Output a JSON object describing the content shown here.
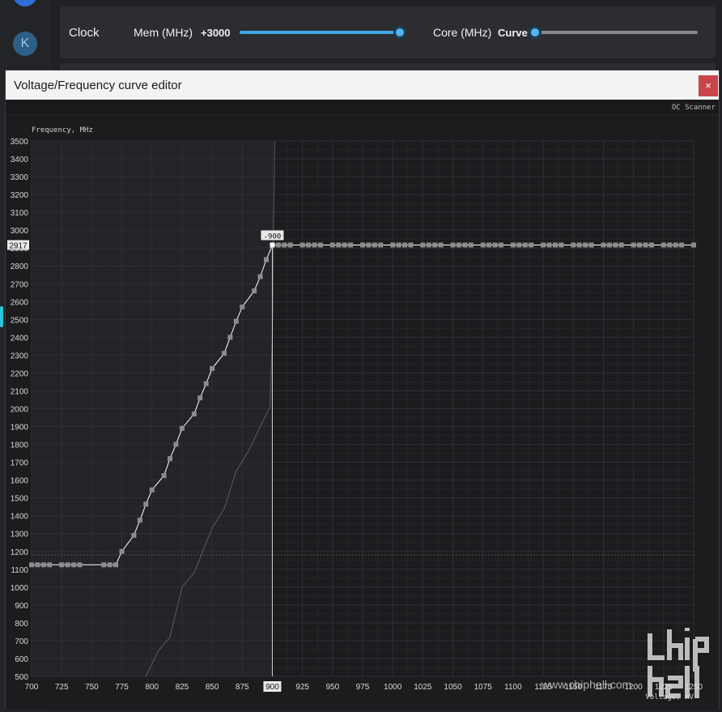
{
  "sidebar": {
    "avatar_letter": "K"
  },
  "clock_panel": {
    "label": "Clock",
    "mem_label": "Mem (MHz)",
    "mem_value": "+3000",
    "mem_slider_fraction": 1.0,
    "core_label": "Core (MHz)",
    "core_value": "Curve",
    "core_slider_fraction": 0.0
  },
  "editor": {
    "title": "Voltage/Frequency curve editor",
    "close_glyph": "×",
    "oc_scanner_label": "OC Scanner",
    "watermark_url": "www.chiphell.com"
  },
  "colors": {
    "accent": "#3fa7e8",
    "close": "#c8454a",
    "curve": "#ffffff",
    "point": "#8c8c8c",
    "selected_label_bg": "#e8e8e8"
  },
  "chart_data": {
    "type": "line",
    "ylabel": "Frequency, MHz",
    "xlabel": "Voltage, mV",
    "xlim": [
      700,
      1250
    ],
    "ylim": [
      500,
      3500
    ],
    "x_ticks": [
      700,
      725,
      750,
      775,
      800,
      825,
      850,
      875,
      900,
      925,
      950,
      975,
      1000,
      1025,
      1050,
      1075,
      1100,
      1125,
      1150,
      1175,
      1200,
      1225,
      1250
    ],
    "y_ticks": [
      500,
      600,
      700,
      800,
      900,
      1000,
      1100,
      1200,
      1300,
      1400,
      1500,
      1600,
      1700,
      1800,
      1900,
      2000,
      2100,
      2200,
      2300,
      2400,
      2500,
      2600,
      2700,
      2800,
      2900,
      3000,
      3100,
      3200,
      3300,
      3400,
      3500
    ],
    "selected_point": {
      "voltage": 900,
      "frequency": 2917,
      "voltage_label": "900",
      "frequency_label": "2917",
      "marker_label": "-900"
    },
    "locked_line_frequency": 1180,
    "series": [
      {
        "points": [
          [
            700,
            1125
          ],
          [
            705,
            1125
          ],
          [
            710,
            1125
          ],
          [
            715,
            1125
          ],
          [
            725,
            1125
          ],
          [
            730,
            1125
          ],
          [
            735,
            1125
          ],
          [
            740,
            1125
          ],
          [
            760,
            1125
          ],
          [
            765,
            1125
          ],
          [
            770,
            1125
          ],
          [
            775,
            1200
          ],
          [
            785,
            1290
          ],
          [
            790,
            1375
          ],
          [
            795,
            1465
          ],
          [
            800,
            1545
          ],
          [
            810,
            1625
          ],
          [
            815,
            1720
          ],
          [
            820,
            1800
          ],
          [
            825,
            1890
          ],
          [
            835,
            1970
          ],
          [
            840,
            2060
          ],
          [
            845,
            2140
          ],
          [
            850,
            2225
          ],
          [
            860,
            2310
          ],
          [
            865,
            2400
          ],
          [
            870,
            2490
          ],
          [
            875,
            2570
          ],
          [
            885,
            2660
          ],
          [
            890,
            2740
          ],
          [
            895,
            2835
          ],
          [
            900,
            2917
          ],
          [
            905,
            2917
          ],
          [
            910,
            2917
          ],
          [
            915,
            2917
          ],
          [
            925,
            2917
          ],
          [
            930,
            2917
          ],
          [
            935,
            2917
          ],
          [
            940,
            2917
          ],
          [
            950,
            2917
          ],
          [
            955,
            2917
          ],
          [
            960,
            2917
          ],
          [
            965,
            2917
          ],
          [
            975,
            2917
          ],
          [
            980,
            2917
          ],
          [
            985,
            2917
          ],
          [
            990,
            2917
          ],
          [
            1000,
            2917
          ],
          [
            1005,
            2917
          ],
          [
            1010,
            2917
          ],
          [
            1015,
            2917
          ],
          [
            1025,
            2917
          ],
          [
            1030,
            2917
          ],
          [
            1035,
            2917
          ],
          [
            1040,
            2917
          ],
          [
            1050,
            2917
          ],
          [
            1055,
            2917
          ],
          [
            1060,
            2917
          ],
          [
            1065,
            2917
          ],
          [
            1075,
            2917
          ],
          [
            1080,
            2917
          ],
          [
            1085,
            2917
          ],
          [
            1090,
            2917
          ],
          [
            1100,
            2917
          ],
          [
            1105,
            2917
          ],
          [
            1110,
            2917
          ],
          [
            1115,
            2917
          ],
          [
            1125,
            2917
          ],
          [
            1130,
            2917
          ],
          [
            1135,
            2917
          ],
          [
            1140,
            2917
          ],
          [
            1150,
            2917
          ],
          [
            1155,
            2917
          ],
          [
            1160,
            2917
          ],
          [
            1165,
            2917
          ],
          [
            1175,
            2917
          ],
          [
            1180,
            2917
          ],
          [
            1185,
            2917
          ],
          [
            1190,
            2917
          ],
          [
            1200,
            2917
          ],
          [
            1205,
            2917
          ],
          [
            1210,
            2917
          ],
          [
            1215,
            2917
          ],
          [
            1225,
            2917
          ],
          [
            1230,
            2917
          ],
          [
            1235,
            2917
          ],
          [
            1240,
            2917
          ],
          [
            1250,
            2917
          ]
        ]
      },
      {
        "points": [
          [
            795,
            500
          ],
          [
            805,
            640
          ],
          [
            815,
            720
          ],
          [
            825,
            1000
          ],
          [
            835,
            1080
          ],
          [
            850,
            1330
          ],
          [
            860,
            1440
          ],
          [
            870,
            1650
          ],
          [
            880,
            1760
          ],
          [
            890,
            1900
          ],
          [
            898,
            2010
          ],
          [
            900,
            2400
          ],
          [
            901,
            3000
          ],
          [
            902,
            3500
          ]
        ]
      }
    ]
  }
}
